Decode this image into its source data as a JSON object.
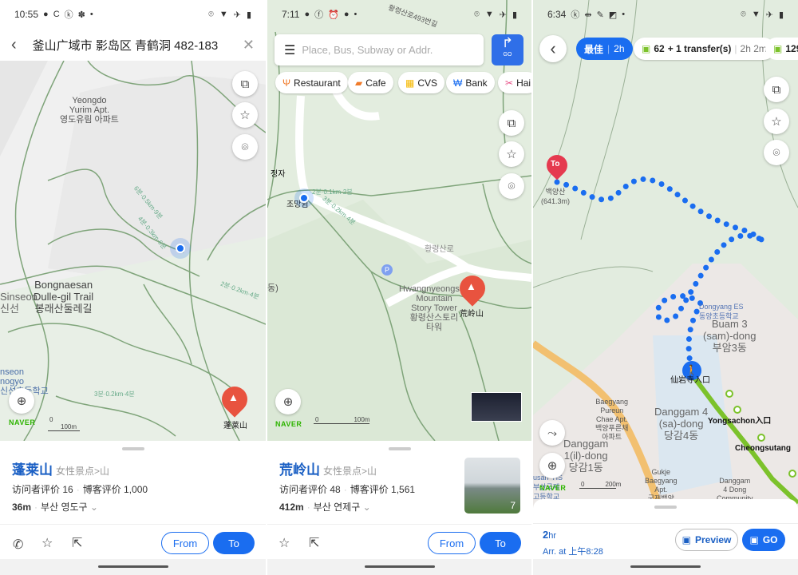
{
  "panel1": {
    "status": {
      "time": "10:55",
      "icons": [
        "messenger-icon",
        "c-icon",
        "k-icon",
        "leaf-icon",
        "dot-icon"
      ],
      "right_icons": [
        "location-icon",
        "wifi-icon",
        "airplane-icon",
        "battery-icon"
      ]
    },
    "header": {
      "address": "釜山广域市 影岛区 青鹤洞 482-183"
    },
    "map": {
      "labels": {
        "apt": "Yeongdo\nYurim Apt.\n영도유림 아파트",
        "trail": "Bongnaesan\nDulle-gil Trail\n봉래산둘레길",
        "sinseon": "Sinseon\n신선",
        "school": "nseon\nnogyo\n신선초등학교",
        "marker": "蓬莱山",
        "trail1": "3분·0.2km·4분",
        "trail2": "2분·0.2km·4분",
        "trail3": "4분·0.3km·6분",
        "trail4": "6분·0.5km·9분"
      },
      "scale": {
        "zero": "0",
        "dist": "100m"
      },
      "brand": "NAVER"
    },
    "sheet": {
      "name": "蓬莱山",
      "category": "女性景点>山",
      "visitor_reviews": "访问者评价 16",
      "blog_reviews": "博客评价 1,000",
      "distance": "36m",
      "region": "부산 영도구",
      "from": "From",
      "to": "To"
    }
  },
  "panel2": {
    "status": {
      "time": "7:11",
      "icons": [
        "messenger-icon",
        "facebook-icon",
        "alarm-icon",
        "chat-icon",
        "dot-icon"
      ],
      "right_icons": [
        "location-icon",
        "wifi-icon",
        "airplane-icon",
        "battery-icon"
      ]
    },
    "search": {
      "placeholder": "Place, Bus, Subway or Addr.",
      "go": "GO"
    },
    "chips": [
      {
        "label": "Restaurant",
        "icon": "fork-knife-icon",
        "color": "#f07b2a"
      },
      {
        "label": "Cafe",
        "icon": "cup-icon",
        "color": "#f07b2a"
      },
      {
        "label": "CVS",
        "icon": "store-icon",
        "color": "#f5b800"
      },
      {
        "label": "Bank",
        "icon": "won-icon",
        "color": "#1a6df0"
      },
      {
        "label": "Hai",
        "icon": "scissors-icon",
        "color": "#e9558a"
      }
    ],
    "map": {
      "labels": {
        "road_top": "황령산로493번길",
        "jungja": "정자",
        "lookout": "조망쉼",
        "road": "황령산로",
        "tower": "Hwangnyeongsan\nMountain\nStory Tower\n황령산스토리\n타워",
        "marker": "荒岭山",
        "trail": "3분·0.2km·4분",
        "trail2": "2분·0.1km·2분",
        "edge": "동)"
      },
      "scale": {
        "zero": "0",
        "dist": "100m"
      },
      "brand": "NAVER"
    },
    "sheet": {
      "name": "荒岭山",
      "category": "女性景点>山",
      "visitor_reviews": "访问者评价 48",
      "blog_reviews": "博客评价 1,561",
      "distance": "412m",
      "region": "부산 연제구",
      "photo_count": "7",
      "from": "From",
      "to": "To"
    }
  },
  "panel3": {
    "status": {
      "time": "6:34",
      "icons": [
        "k-icon",
        "arrows-icon",
        "edit-icon",
        "image-icon",
        "dot-icon"
      ],
      "right_icons": [
        "location-icon",
        "wifi-icon",
        "airplane-icon",
        "battery-icon"
      ]
    },
    "routes": [
      {
        "label": "最佳",
        "time": "2h",
        "selected": true
      },
      {
        "bus": "62",
        "transfer": "+ 1 transfer(s)",
        "time": "2h 2m"
      },
      {
        "bus": "129"
      }
    ],
    "map": {
      "labels": {
        "to_pin": "To",
        "peak": "백양산\n(641.3m)",
        "school": "Dongyang ES\n동양초등학교",
        "buam": "Buam 3\n(sam)-dong\n부암3동",
        "start": "仙岩寺入口",
        "apt": "Baegyang\nPureun\nChae Apt.\n백양푸른채\n아파트",
        "danggam4": "Danggam 4\n(sa)-dong\n당감4동",
        "yongsachon": "Yongsachon入口",
        "danggam1": "Danggam\n1(il)-dong\n당감1동",
        "cheongsutang": "Cheongsutang",
        "gukje": "Gukje\nBaegyang\nApt.\n국제백양",
        "community": "Danggam\n4 Dong\nCommunity",
        "busan": "usan  HS\n부산국제\n고등학교"
      },
      "scale": {
        "zero": "0",
        "dist": "200m"
      },
      "brand": "NAVER",
      "route_color": "#1a6df0",
      "bus_color": "#7cc22b"
    },
    "sheet": {
      "duration_num": "2",
      "duration_unit": "hr",
      "arrival": "Arr. at 上午8:28",
      "preview": "Preview",
      "go": "GO"
    }
  }
}
